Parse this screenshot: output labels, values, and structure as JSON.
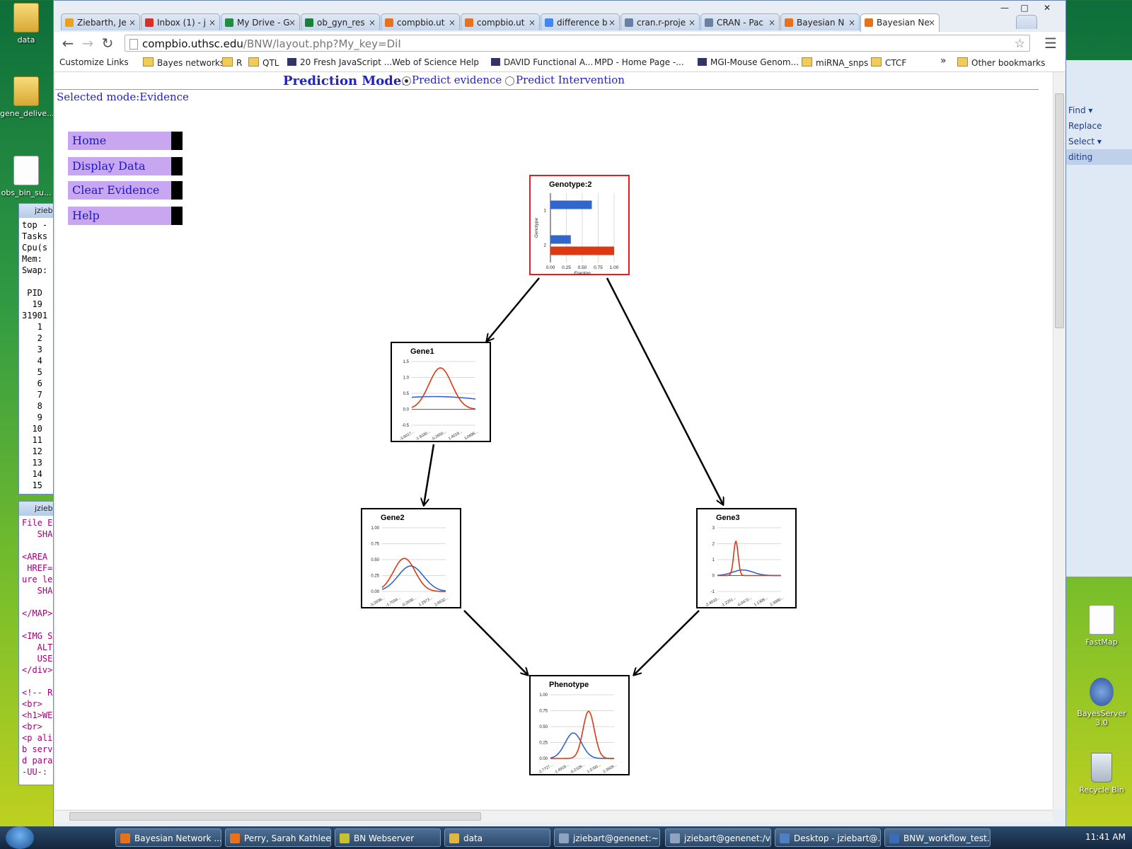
{
  "desktop": {
    "icons": [
      {
        "label": "data",
        "kind": "folder"
      },
      {
        "label": "gene_delive...",
        "kind": "folder"
      },
      {
        "label": "obs_bin_su...",
        "kind": "doc"
      },
      {
        "label": "FastMap",
        "kind": "app"
      },
      {
        "label": "BayesServer 3.0",
        "kind": "app"
      },
      {
        "label": "Recycle Bin",
        "kind": "bin"
      }
    ],
    "terminal_lines": [
      "top -",
      "Tasks",
      "Cpu(s",
      "Mem:",
      "Swap:",
      "",
      " PID",
      "  19",
      "31901",
      "   1",
      "   2",
      "   3",
      "   4",
      "   5",
      "   6",
      "   7",
      "   8",
      "   9",
      "  10",
      "  11",
      "  12",
      "  13",
      "  14",
      "  15"
    ],
    "editor_lines": [
      "File E",
      "   SHA",
      "",
      "<AREA",
      " HREF=",
      "ure le",
      "   SHA",
      "",
      "</MAP>",
      "",
      "<IMG S",
      "   ALT",
      "   USE",
      "</div>",
      "",
      "<!-- R",
      "<br>",
      "<h1>WE",
      "<br>",
      "<p ali",
      "b serv",
      "d para",
      "-UU-:"
    ],
    "right_panel_items": [
      "Find ▾",
      "Replace",
      "Select ▾",
      "diting"
    ]
  },
  "browser": {
    "tabs": [
      {
        "label": "Ziebarth, Je",
        "color": "#e8a21b"
      },
      {
        "label": "Inbox (1) - j",
        "color": "#d93025"
      },
      {
        "label": "My Drive - G",
        "color": "#1e8e3e"
      },
      {
        "label": "ob_gyn_res",
        "color": "#188038"
      },
      {
        "label": "compbio.ut",
        "color": "#e8711b"
      },
      {
        "label": "compbio.ut",
        "color": "#e8711b"
      },
      {
        "label": "difference b",
        "color": "#4285f4"
      },
      {
        "label": "cran.r-proje",
        "color": "#6b7fa3"
      },
      {
        "label": "CRAN - Pac",
        "color": "#6b7fa3"
      },
      {
        "label": "Bayesian N",
        "color": "#e8711b"
      },
      {
        "label": "Bayesian Ne",
        "color": "#e8711b",
        "active": true
      }
    ],
    "url_host": "compbio.uthsc.edu",
    "url_path": "/BNW/layout.php?My_key=DiI",
    "bookmarks": [
      {
        "label": "Customize Links",
        "icon": "page"
      },
      {
        "label": "Bayes networks",
        "icon": "fold"
      },
      {
        "label": "R",
        "icon": "fold"
      },
      {
        "label": "QTL",
        "icon": "fold"
      },
      {
        "label": "20 Fresh JavaScript ...",
        "icon": "img"
      },
      {
        "label": "Web of Science Help",
        "icon": "page"
      },
      {
        "label": "DAVID Functional A...",
        "icon": "img"
      },
      {
        "label": "MPD - Home Page -...",
        "icon": "page"
      },
      {
        "label": "MGI-Mouse Genom...",
        "icon": "img"
      },
      {
        "label": "miRNA_snps",
        "icon": "fold"
      },
      {
        "label": "CTCF",
        "icon": "fold"
      }
    ],
    "other_bookmarks": "Other bookmarks",
    "more_bookmarks": "»"
  },
  "page": {
    "mode_title": "Prediction Mode:",
    "radio_evidence": "Predict evidence",
    "radio_intervention": "Predict Intervention",
    "selected_mode": "Selected mode:Evidence",
    "menu": [
      "Home",
      "Display Data",
      "Clear Evidence",
      "Help"
    ],
    "nodes": {
      "genotype": {
        "title": "Genotype:2"
      },
      "gene1": {
        "title": "Gene1"
      },
      "gene2": {
        "title": "Gene2"
      },
      "gene3": {
        "title": "Gene3"
      },
      "phenotype": {
        "title": "Phenotype"
      }
    }
  },
  "colors": {
    "baseline": "#3366cc",
    "updated": "#dc3912",
    "link": "#2222cc",
    "menu_bg": "#c8a6f0",
    "selected_border": "#e51f1f"
  },
  "chart_data": [
    {
      "type": "bar",
      "title": "Genotype:2",
      "orientation": "horizontal",
      "categories": [
        "1",
        "2"
      ],
      "series": [
        {
          "values": [
            0.65,
            0.32
          ]
        },
        {
          "values": [
            0.0,
            1.0
          ]
        }
      ],
      "xlabel": "Fraction",
      "ylabel": "Genotype",
      "xlim": [
        0,
        1
      ],
      "xticks": [
        "0.00",
        "0.25",
        "0.50",
        "0.75",
        "1.00"
      ]
    },
    {
      "type": "line",
      "title": "Gene1",
      "ylim": [
        -0.5,
        1.5
      ],
      "yticks": [
        "-0.5",
        "0.0",
        "0.5",
        "1.0",
        "1.5"
      ],
      "xticks": [
        "-3.6017...",
        "-1.9330...",
        "-0.2650...",
        "1.4019...",
        "3.0696..."
      ],
      "curves": [
        {
          "mean": 0.35,
          "sd": 1.0,
          "peak": 0.4
        },
        {
          "mean": 0.45,
          "sd": 0.18,
          "peak": 1.3
        }
      ]
    },
    {
      "type": "line",
      "title": "Gene2",
      "ylim": [
        0,
        1.0
      ],
      "yticks": [
        "0.00",
        "0.25",
        "0.50",
        "0.75",
        "1.00"
      ],
      "xticks": [
        "-3.2038...",
        "-1.7034...",
        "-0.2030...",
        "1.2973...",
        "2.6532..."
      ],
      "curves": [
        {
          "mean": 0.45,
          "sd": 0.2,
          "peak": 0.4
        },
        {
          "mean": 0.35,
          "sd": 0.17,
          "peak": 0.52
        }
      ]
    },
    {
      "type": "line",
      "title": "Gene3",
      "ylim": [
        -1,
        3
      ],
      "yticks": [
        "-1",
        "0",
        "1",
        "2",
        "3"
      ],
      "xticks": [
        "-2.4010...",
        "-1.2251...",
        "-0.0472...",
        "1.1308...",
        "2.3080..."
      ],
      "curves": [
        {
          "mean": 0.4,
          "sd": 0.16,
          "peak": 0.35
        },
        {
          "mean": 0.29,
          "sd": 0.035,
          "peak": 2.15
        }
      ]
    },
    {
      "type": "line",
      "title": "Phenotype",
      "ylim": [
        0,
        1.0
      ],
      "yticks": [
        "0.00",
        "0.25",
        "0.50",
        "0.75",
        "1.00"
      ],
      "xticks": [
        "-2.7727...",
        "-1.4918...",
        "-0.2109...",
        "1.0700...",
        "2.3509..."
      ],
      "curves": [
        {
          "mean": 0.36,
          "sd": 0.13,
          "peak": 0.4
        },
        {
          "mean": 0.6,
          "sd": 0.09,
          "peak": 0.74
        }
      ]
    }
  ],
  "taskbar": {
    "items": [
      {
        "label": "Bayesian Network ...",
        "color": "#e8711b"
      },
      {
        "label": "Perry, Sarah Kathlee...",
        "color": "#e8711b"
      },
      {
        "label": "BN Webserver",
        "color": "#c8c030"
      },
      {
        "label": "data",
        "color": "#e0b640"
      },
      {
        "label": "jziebart@genenet:~",
        "color": "#8ea3c0"
      },
      {
        "label": "jziebart@genenet:/v...",
        "color": "#8ea3c0"
      },
      {
        "label": "Desktop - jziebart@...",
        "color": "#4f7fc0"
      },
      {
        "label": "BNW_workflow_test...",
        "color": "#3a6db5"
      }
    ],
    "clock": "11:41 AM"
  }
}
